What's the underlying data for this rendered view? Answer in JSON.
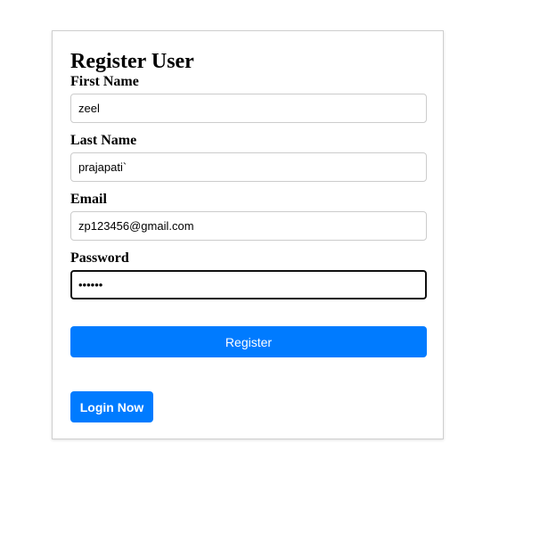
{
  "form": {
    "title": "Register User",
    "first_name": {
      "label": "First Name",
      "value": "zeel"
    },
    "last_name": {
      "label": "Last Name",
      "value": "prajapati`"
    },
    "email": {
      "label": "Email",
      "value": "zp123456@gmail.com"
    },
    "password": {
      "label": "Password",
      "value": "••••••"
    },
    "register_label": "Register",
    "login_label": "Login Now"
  },
  "colors": {
    "accent": "#007bff",
    "border": "#cccccc",
    "focus_border": "#101010"
  }
}
